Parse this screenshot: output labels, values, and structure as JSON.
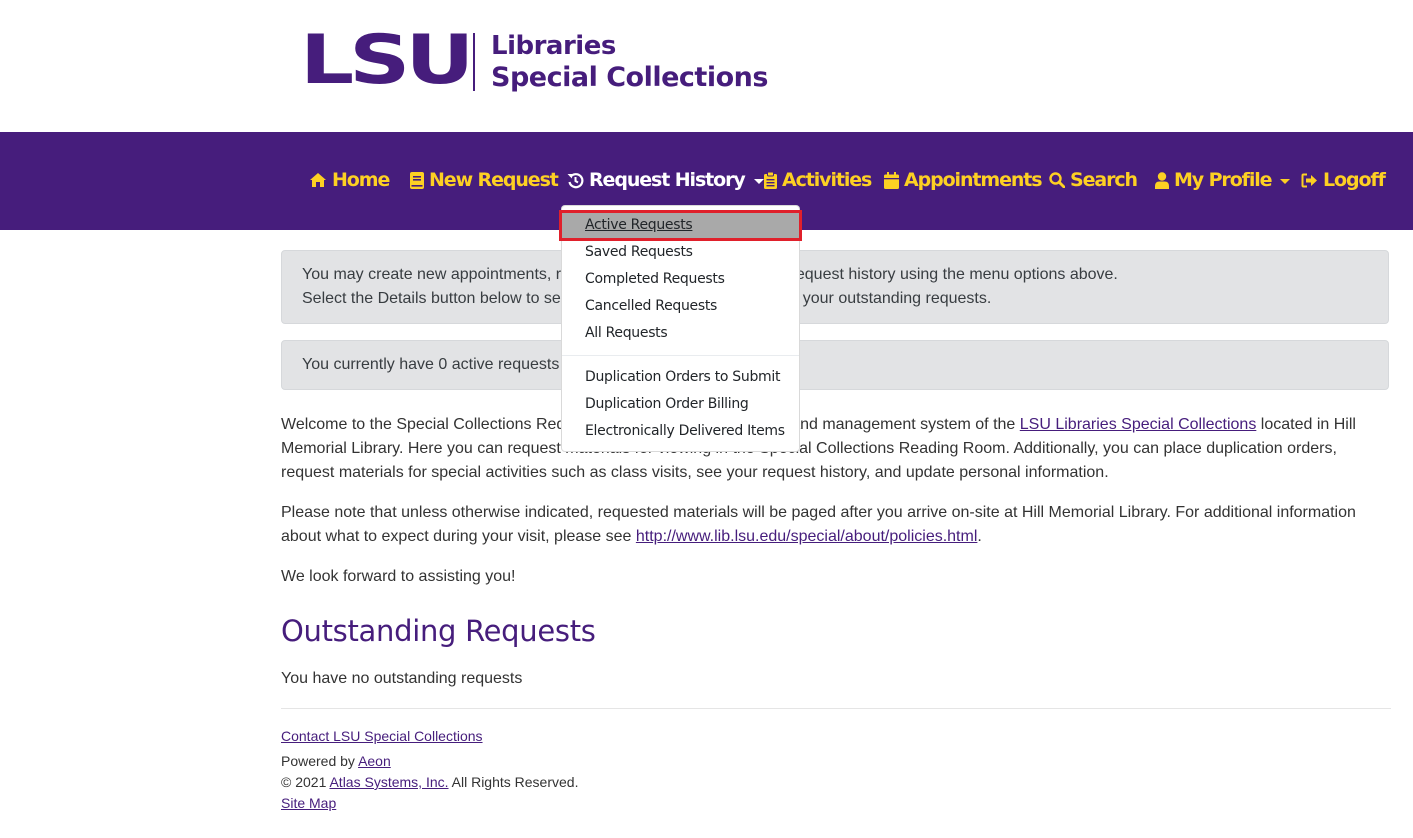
{
  "logo": {
    "mark": "LSU",
    "line1": "Libraries",
    "line2": "Special Collections"
  },
  "colors": {
    "brand_purple": "#461d7c",
    "brand_gold": "#fdd023",
    "alert_bg": "#e2e3e5",
    "highlight_red": "#e0202b"
  },
  "nav": {
    "items": [
      {
        "label": "Home",
        "icon": "home-icon"
      },
      {
        "label": "New Request",
        "icon": "book-icon"
      },
      {
        "label": "Request History",
        "icon": "history-icon",
        "dropdown": true,
        "active": true
      },
      {
        "label": "Activities",
        "icon": "clipboard-icon"
      },
      {
        "label": "Appointments",
        "icon": "calendar-icon"
      },
      {
        "label": "Search",
        "icon": "search-icon"
      },
      {
        "label": "My Profile",
        "icon": "user-icon",
        "dropdown": true
      },
      {
        "label": "Logoff",
        "icon": "sign-out-icon"
      }
    ]
  },
  "dropdown": {
    "group1": [
      "Active Requests",
      "Saved Requests",
      "Completed Requests",
      "Cancelled Requests",
      "All Requests"
    ],
    "group2": [
      "Duplication Orders to Submit",
      "Duplication Order Billing",
      "Electronically Delivered Items"
    ],
    "selected": "Active Requests"
  },
  "alerts": {
    "info_line1": "You may create new appointments, request materials, and view your request history using the menu options above.",
    "info_line2": "Select the Details button below to see additional information regarding your outstanding requests.",
    "count": "You currently have 0 active requests"
  },
  "intro": {
    "p1_a": "Welcome to the Special Collections Request system, the online request and management system of the ",
    "p1_link": "LSU Libraries Special Collections",
    "p1_b": " located in Hill Memorial Library. Here you can request materials for viewing in the Special Collections Reading Room. Additionally, you can place duplication orders, request materials for special activities such as class visits, see your request history, and update personal information.",
    "p2_a": "Please note that unless otherwise indicated, requested materials will be paged after you arrive on-site at Hill Memorial Library. For additional information about what to expect during your visit, please see ",
    "p2_link": "http://www.lib.lsu.edu/special/about/policies.html",
    "p2_b": ".",
    "p3": "We look forward to assisting you!"
  },
  "outstanding": {
    "heading": "Outstanding Requests",
    "empty": "You have no outstanding requests"
  },
  "footer": {
    "contact": "Contact LSU Special Collections",
    "powered_prefix": "Powered by ",
    "powered_link": "Aeon",
    "copyright_prefix": "© 2021 ",
    "copyright_link": "Atlas Systems, Inc.",
    "copyright_suffix": " All Rights Reserved.",
    "sitemap": "Site Map"
  }
}
